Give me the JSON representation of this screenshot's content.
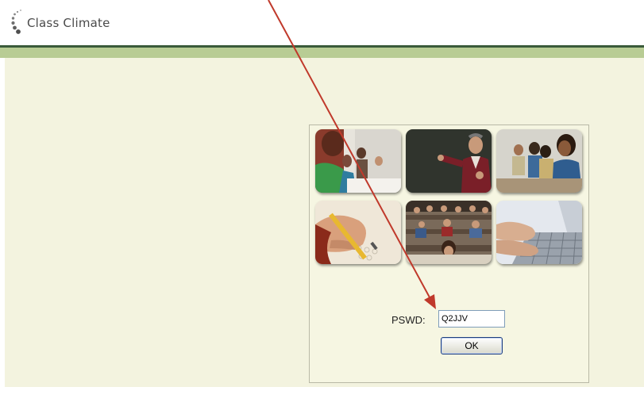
{
  "app": {
    "logo_text": "Class Climate"
  },
  "login": {
    "password_label": "PSWD:",
    "password_value": "Q2JJV",
    "ok_label": "OK"
  },
  "photos": [
    {
      "name": "photo-students-writing"
    },
    {
      "name": "photo-teacher-chalkboard"
    },
    {
      "name": "photo-students-listening"
    },
    {
      "name": "photo-hand-pencil-form"
    },
    {
      "name": "photo-lecture-hall"
    },
    {
      "name": "photo-hands-keyboard"
    }
  ],
  "colors": {
    "header_bar": "#3a5a3a",
    "green_band": "#b8cc94",
    "background": "#f3f3df",
    "annotation_arrow": "#c0392b"
  }
}
